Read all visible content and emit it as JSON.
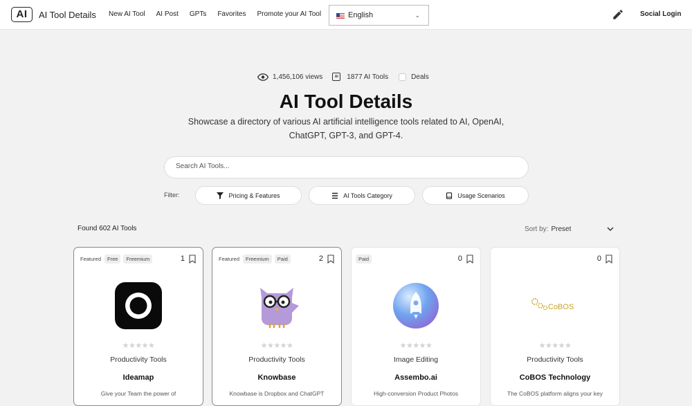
{
  "header": {
    "logo": "AI",
    "brand": "AI Tool Details",
    "nav": [
      "New AI Tool",
      "AI Post",
      "GPTs",
      "Favorites",
      "Promote your AI Tool"
    ],
    "language": "English",
    "social_login": "Social Login"
  },
  "stats": {
    "views": "1,456,106 views",
    "tools": "1877 AI Tools",
    "deals": "Deals"
  },
  "hero": {
    "title": "AI Tool Details",
    "subtitle": "Showcase a directory of various AI artificial intelligence tools related to AI, OpenAI, ChatGPT, GPT-3, and GPT-4."
  },
  "search": {
    "placeholder": "Search AI Tools..."
  },
  "filter": {
    "label": "Filter:",
    "pricing": "Pricing & Features",
    "category": "AI Tools Category",
    "scenarios": "Usage Scenarios"
  },
  "results": {
    "found": "Found 602 AI Tools",
    "sort_label": "Sort by:",
    "sort_value": "Preset"
  },
  "cards": [
    {
      "tags": [
        "Featured",
        "Free",
        "Freemium"
      ],
      "count": "1",
      "category": "Productivity Tools",
      "name": "Ideamap",
      "desc": "Give your Team the power of",
      "icon": "ideamap-logo"
    },
    {
      "tags": [
        "Featured",
        "Freemium",
        "Paid"
      ],
      "count": "2",
      "category": "Productivity Tools",
      "name": "Knowbase",
      "desc": "Knowbase is Dropbox and ChatGPT",
      "icon": "owl-logo"
    },
    {
      "tags": [
        "Paid"
      ],
      "count": "0",
      "category": "Image Editing",
      "name": "Assembo.ai",
      "desc": "High-conversion Product Photos",
      "icon": "rocket-logo"
    },
    {
      "tags": [],
      "count": "0",
      "category": "Productivity Tools",
      "name": "CoBOS Technology",
      "desc": "The CoBOS platform aligns your key",
      "icon": "cobos-logo",
      "logo_text": "CoBOS"
    }
  ],
  "colors": {
    "accent": "#222222",
    "cobos_gold": "#c9a227"
  }
}
